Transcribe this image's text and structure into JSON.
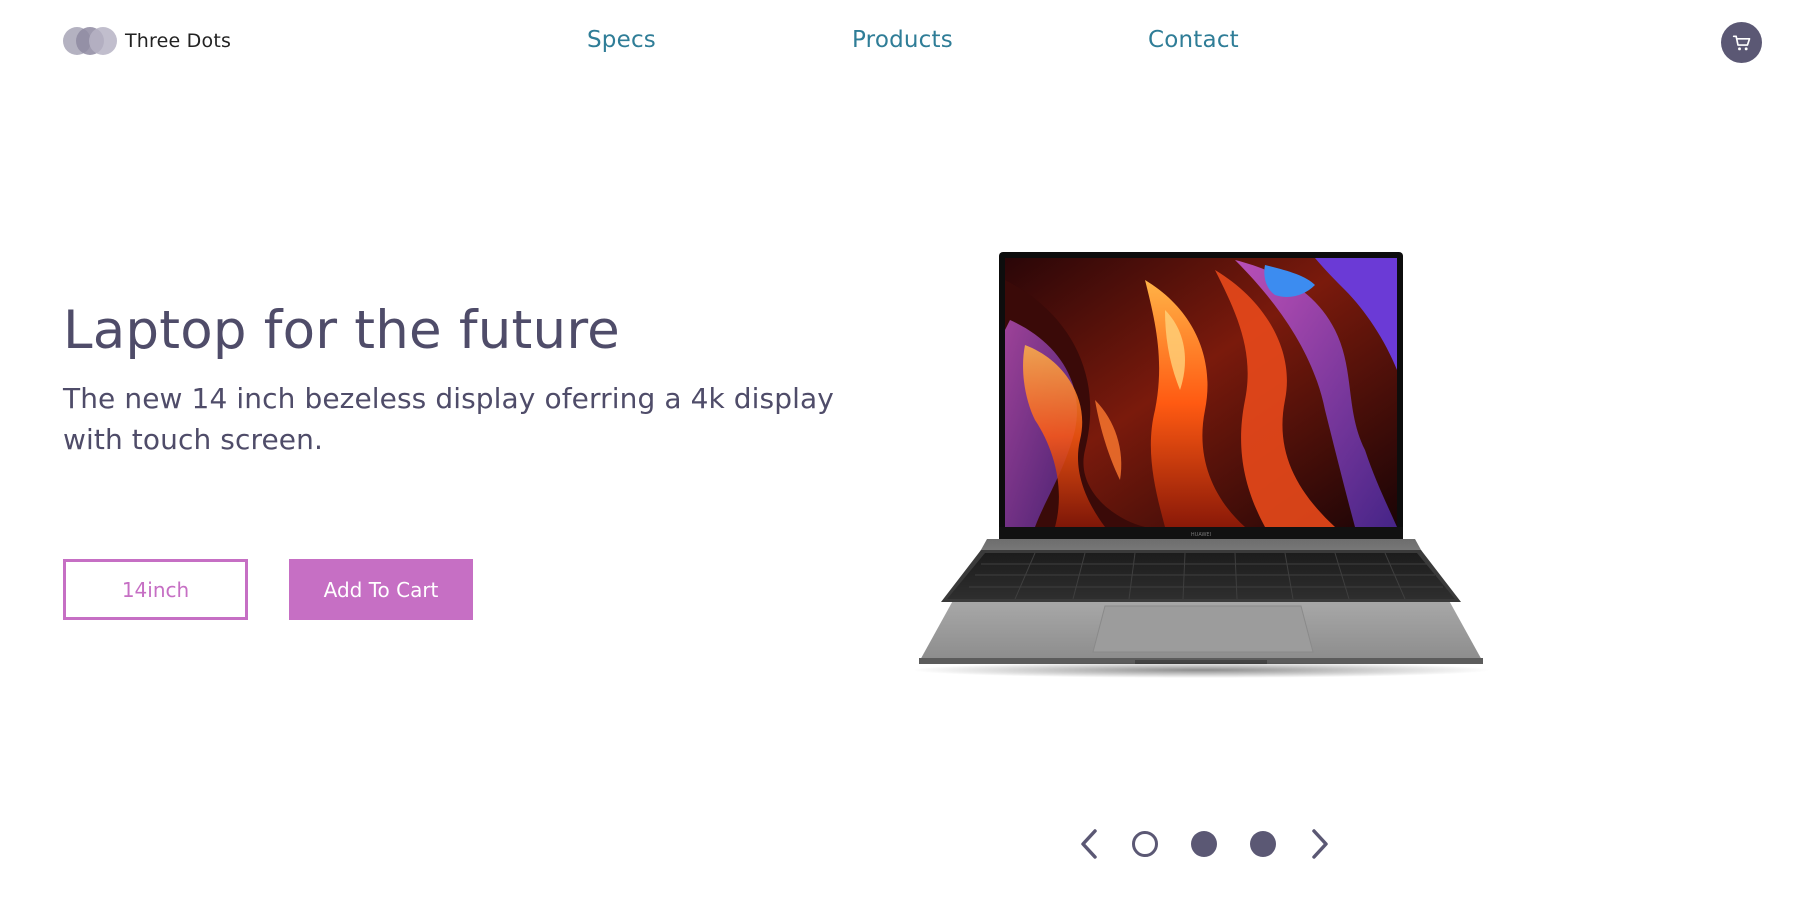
{
  "header": {
    "logo_text": "Three Dots",
    "nav": {
      "specs": "Specs",
      "products": "Products",
      "contact": "Contact"
    },
    "cart_icon": "cart-icon"
  },
  "hero": {
    "title": "Laptop for the future",
    "description": "The new 14 inch bezeless display oferring a 4k display with touch screen.",
    "size_button": "14inch",
    "add_to_cart_button": "Add To Cart",
    "product_image": "laptop-image",
    "laptop_brand_text": "HUAWEI"
  },
  "carousel": {
    "prev_icon": "chevron-left-icon",
    "next_icon": "chevron-right-icon",
    "slide_count": 3,
    "active_slide": 1
  },
  "colors": {
    "accent": "#c66fc4",
    "nav_link": "#2f7d97",
    "heading": "#4f4c69",
    "cart_bg": "#5b5874"
  }
}
